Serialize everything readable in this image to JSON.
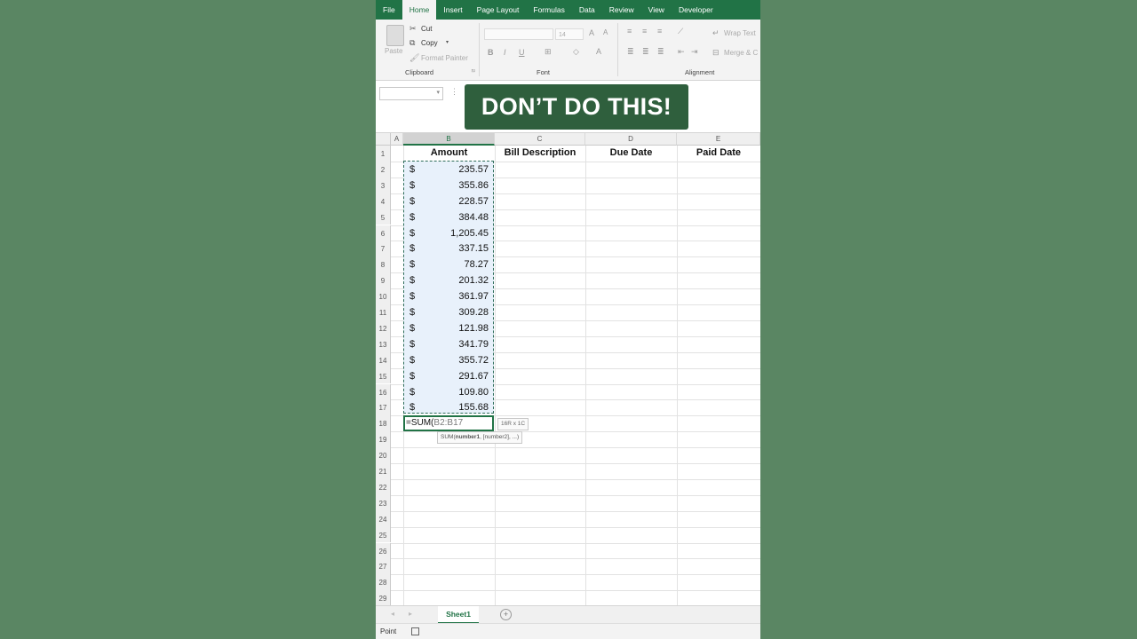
{
  "ribbon": {
    "tabs": [
      "File",
      "Home",
      "Insert",
      "Page Layout",
      "Formulas",
      "Data",
      "Review",
      "View",
      "Developer"
    ],
    "active_tab": "Home",
    "clipboard": {
      "paste": "Paste",
      "cut": "Cut",
      "copy": "Copy",
      "format_painter": "Format Painter",
      "label": "Clipboard"
    },
    "font": {
      "font_size": "14",
      "label": "Font",
      "bold": "B",
      "italic": "I",
      "underline": "U"
    },
    "alignment": {
      "wrap_text": "Wrap Text",
      "merge": "Merge & C",
      "label": "Alignment"
    }
  },
  "formula_bar": {
    "name_box": "",
    "dots": "⋮"
  },
  "overlay": {
    "banner_text": "DON’T DO THIS!"
  },
  "sheet": {
    "col_headers": [
      "A",
      "B",
      "C",
      "D",
      "E"
    ],
    "headers": {
      "amount": "Amount",
      "bill_description": "Bill Description",
      "due_date": "Due Date",
      "paid_date": "Paid Date"
    },
    "currency_symbol": "$",
    "amounts": [
      "235.57",
      "355.86",
      "228.57",
      "384.48",
      "1,205.45",
      "337.15",
      "78.27",
      "201.32",
      "361.97",
      "309.28",
      "121.98",
      "341.79",
      "355.72",
      "291.67",
      "109.80",
      "155.68"
    ],
    "row_numbers": [
      "1",
      "2",
      "3",
      "4",
      "5",
      "6",
      "7",
      "8",
      "9",
      "10",
      "11",
      "12",
      "13",
      "14",
      "15",
      "16",
      "17",
      "18",
      "19",
      "20",
      "21",
      "22",
      "23",
      "24",
      "25",
      "26",
      "27",
      "28",
      "29"
    ],
    "active_cell": {
      "prefix": "=SUM(",
      "ref": "B2:B17"
    },
    "range_tooltip": "16R x 1C",
    "function_tooltip": {
      "fn": "SUM(",
      "arg1": "number1",
      ", rest": ", [number2], ...)"
    }
  },
  "sheet_tabs": {
    "active": "Sheet1",
    "add": "+"
  },
  "status_bar": {
    "mode": "Point"
  },
  "colors": {
    "excel_green": "#217346",
    "background": "#5a8663",
    "banner": "#2f5f3d"
  }
}
